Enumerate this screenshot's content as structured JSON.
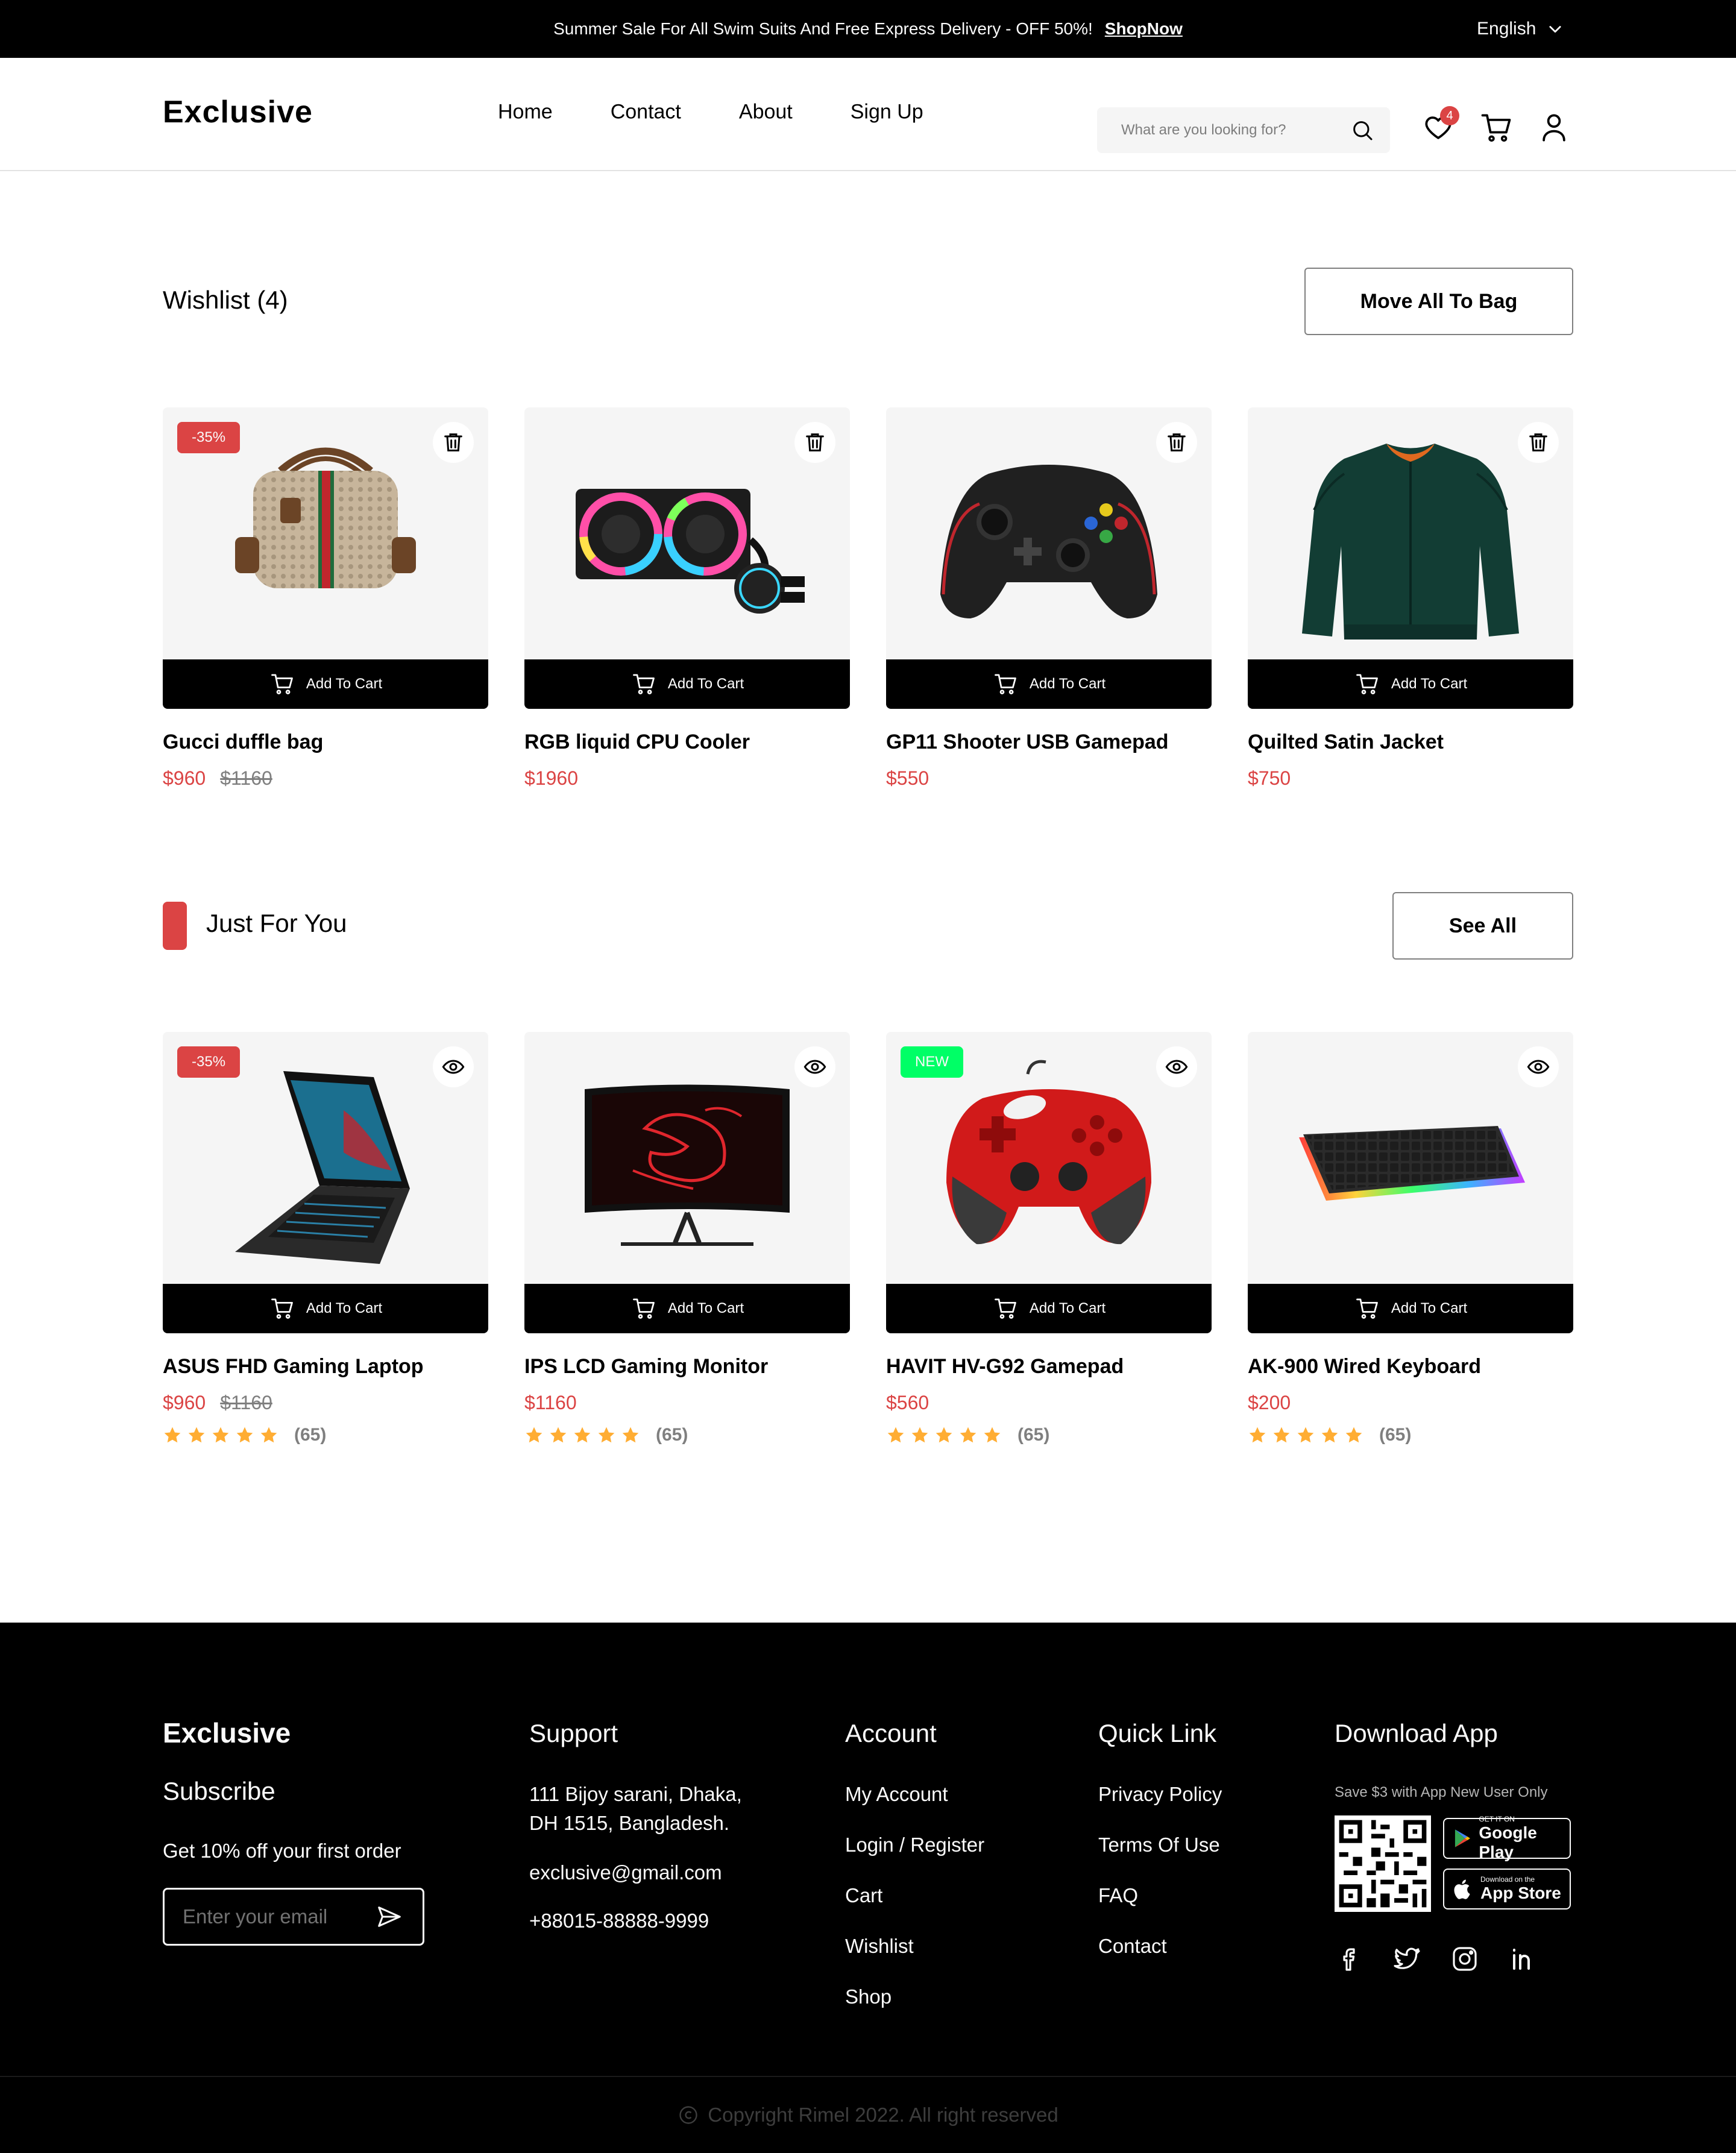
{
  "topbar": {
    "promo_text": "Summer Sale For All Swim Suits And Free Express Delivery - OFF 50%!",
    "promo_link": "ShopNow",
    "language": "English"
  },
  "header": {
    "logo": "Exclusive",
    "nav": [
      "Home",
      "Contact",
      "About",
      "Sign Up"
    ],
    "search_placeholder": "What are you looking for?",
    "wishlist_count": "4"
  },
  "wishlist": {
    "title": "Wishlist (4)",
    "move_all_label": "Move All To Bag",
    "add_to_cart_label": "Add To Cart",
    "items": [
      {
        "name": "Gucci duffle bag",
        "price": "$960",
        "old_price": "$1160",
        "tag": "-35%",
        "icon": "trash-icon"
      },
      {
        "name": "RGB liquid CPU Cooler",
        "price": "$1960",
        "old_price": "",
        "tag": "",
        "icon": "trash-icon"
      },
      {
        "name": "GP11 Shooter USB Gamepad",
        "price": "$550",
        "old_price": "",
        "tag": "",
        "icon": "trash-icon"
      },
      {
        "name": "Quilted Satin Jacket",
        "price": "$750",
        "old_price": "",
        "tag": "",
        "icon": "trash-icon"
      }
    ]
  },
  "just_for_you": {
    "title": "Just For You",
    "see_all_label": "See All",
    "add_to_cart_label": "Add To Cart",
    "items": [
      {
        "name": "ASUS FHD Gaming Laptop",
        "price": "$960",
        "old_price": "$1160",
        "tag": "-35%",
        "rating": 5,
        "reviews": "(65)",
        "icon": "eye-icon"
      },
      {
        "name": "IPS LCD Gaming Monitor",
        "price": "$1160",
        "old_price": "",
        "tag": "",
        "rating": 5,
        "reviews": "(65)",
        "icon": "eye-icon"
      },
      {
        "name": "HAVIT HV-G92 Gamepad",
        "price": "$560",
        "old_price": "",
        "tag": "NEW",
        "rating": 5,
        "reviews": "(65)",
        "icon": "eye-icon"
      },
      {
        "name": "AK-900 Wired Keyboard",
        "price": "$200",
        "old_price": "",
        "tag": "",
        "rating": 5,
        "reviews": "(65)",
        "icon": "eye-icon"
      }
    ]
  },
  "footer": {
    "logo": "Exclusive",
    "subscribe_title": "Subscribe",
    "subscribe_text": "Get 10% off your first order",
    "email_placeholder": "Enter your email",
    "support_title": "Support",
    "address_line1": "111 Bijoy sarani, Dhaka,",
    "address_line2": "DH 1515, Bangladesh.",
    "email": "exclusive@gmail.com",
    "phone": "+88015-88888-9999",
    "account_title": "Account",
    "account_links": [
      "My Account",
      "Login / Register",
      "Cart",
      "Wishlist",
      "Shop"
    ],
    "quick_title": "Quick Link",
    "quick_links": [
      "Privacy Policy",
      "Terms Of Use",
      "FAQ",
      "Contact"
    ],
    "app_title": "Download App",
    "app_text": "Save $3 with App New User Only",
    "google_small": "GET IT ON",
    "google_big": "Google Play",
    "apple_small": "Download on the",
    "apple_big": "App Store",
    "copyright": "Copyright Rimel 2022. All right reserved"
  },
  "colors": {
    "accent": "#DB4444",
    "new_badge": "#00FF66",
    "card_bg": "#F5F5F5",
    "star": "#FFAD33"
  }
}
